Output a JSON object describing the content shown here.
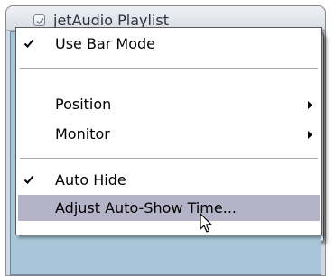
{
  "window": {
    "title": "jetAudio Playlist"
  },
  "menu": {
    "items": [
      {
        "label": "Use Bar Mode",
        "checked": true,
        "submenu": false,
        "highlighted": false
      },
      {
        "label": "Position",
        "checked": false,
        "submenu": true,
        "highlighted": false
      },
      {
        "label": "Monitor",
        "checked": false,
        "submenu": true,
        "highlighted": false
      },
      {
        "label": "Auto Hide",
        "checked": true,
        "submenu": false,
        "highlighted": false
      },
      {
        "label": "Adjust Auto-Show Time...",
        "checked": false,
        "submenu": false,
        "highlighted": true
      }
    ]
  },
  "colors": {
    "highlight": "#b5b3c7",
    "menu_bg": "#ffffff",
    "client_bg": "#a9c6d8"
  },
  "icons": {
    "window_menu": "chevron-down-icon",
    "window_check": "checkbox-icon",
    "checked_item": "checkmark-icon",
    "submenu": "submenu-arrow-icon",
    "pointer": "mouse-pointer-icon"
  }
}
